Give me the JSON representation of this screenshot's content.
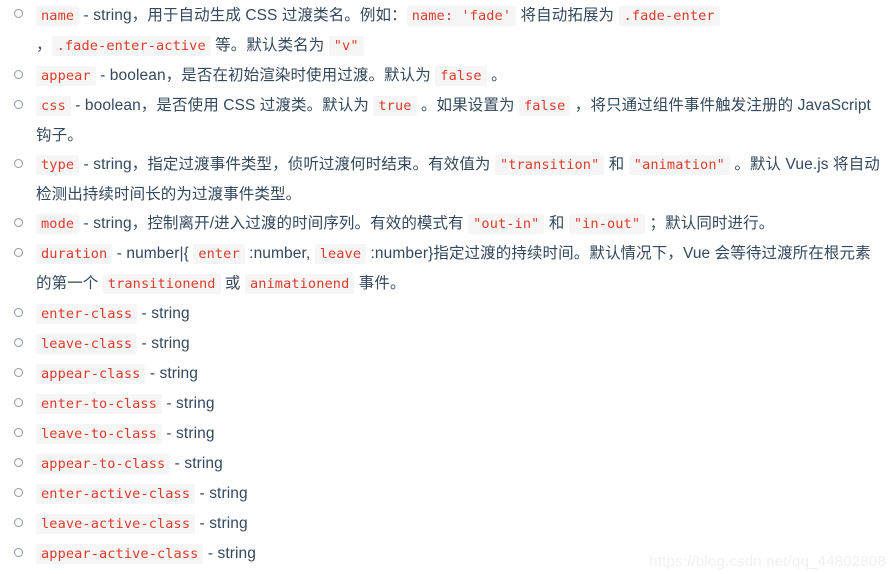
{
  "page": {
    "background": "#ffffff",
    "text_color": "#34495e",
    "code_color": "#e03c2b",
    "code_background": "#f6f6f6",
    "bullet_color": "#8d9aa8",
    "bullet_glyph": "circle-outline"
  },
  "watermark": {
    "text": "https://blog.csdn.net/qq_44802808",
    "color": "#f0f0f0"
  },
  "list": {
    "items": [
      {
        "name": "name-prop",
        "segments": [
          {
            "type": "code",
            "text": "name"
          },
          {
            "type": "text",
            "text": " - string，用于自动生成 CSS 过渡类名。例如："
          },
          {
            "type": "code",
            "text": "name: 'fade'"
          },
          {
            "type": "text",
            "text": " 将自动拓展为 "
          },
          {
            "type": "code",
            "text": ".fade-enter"
          },
          {
            "type": "text",
            "text": " ，"
          },
          {
            "type": "code",
            "text": ".fade-enter-active"
          },
          {
            "type": "text",
            "text": " 等。默认类名为 "
          },
          {
            "type": "code",
            "text": "\"v\""
          }
        ]
      },
      {
        "name": "appear-prop",
        "segments": [
          {
            "type": "code",
            "text": "appear"
          },
          {
            "type": "text",
            "text": " - boolean，是否在初始渲染时使用过渡。默认为 "
          },
          {
            "type": "code",
            "text": "false"
          },
          {
            "type": "text",
            "text": " 。"
          }
        ]
      },
      {
        "name": "css-prop",
        "segments": [
          {
            "type": "code",
            "text": "css"
          },
          {
            "type": "text",
            "text": " - boolean，是否使用 CSS 过渡类。默认为 "
          },
          {
            "type": "code",
            "text": "true"
          },
          {
            "type": "text",
            "text": " 。如果设置为 "
          },
          {
            "type": "code",
            "text": "false"
          },
          {
            "type": "text",
            "text": " ，将只通过组件事件触发注册的 JavaScript 钩子。"
          }
        ]
      },
      {
        "name": "type-prop",
        "segments": [
          {
            "type": "code",
            "text": "type"
          },
          {
            "type": "text",
            "text": " - string，指定过渡事件类型，侦听过渡何时结束。有效值为 "
          },
          {
            "type": "code",
            "text": "\"transition\""
          },
          {
            "type": "text",
            "text": " 和 "
          },
          {
            "type": "code",
            "text": "\"animation\""
          },
          {
            "type": "text",
            "text": " 。默认 Vue.js 将自动检测出持续时间长的为过渡事件类型。"
          }
        ]
      },
      {
        "name": "mode-prop",
        "segments": [
          {
            "type": "code",
            "text": "mode"
          },
          {
            "type": "text",
            "text": " - string，控制离开/进入过渡的时间序列。有效的模式有 "
          },
          {
            "type": "code",
            "text": "\"out-in\""
          },
          {
            "type": "text",
            "text": " 和 "
          },
          {
            "type": "code",
            "text": "\"in-out\""
          },
          {
            "type": "text",
            "text": " ；默认同时进行。"
          }
        ]
      },
      {
        "name": "duration-prop",
        "segments": [
          {
            "type": "code",
            "text": "duration"
          },
          {
            "type": "text",
            "text": " - number|{ "
          },
          {
            "type": "code",
            "text": "enter"
          },
          {
            "type": "text",
            "text": " :number, "
          },
          {
            "type": "code",
            "text": "leave"
          },
          {
            "type": "text",
            "text": " :number}指定过渡的持续时间。默认情况下，Vue 会等待过渡所在根元素的第一个 "
          },
          {
            "type": "code",
            "text": "transitionend"
          },
          {
            "type": "text",
            "text": " 或 "
          },
          {
            "type": "code",
            "text": "animationend"
          },
          {
            "type": "text",
            "text": " 事件。"
          }
        ]
      },
      {
        "name": "enter-class-prop",
        "segments": [
          {
            "type": "code",
            "text": "enter-class"
          },
          {
            "type": "text",
            "text": " - string"
          }
        ]
      },
      {
        "name": "leave-class-prop",
        "segments": [
          {
            "type": "code",
            "text": "leave-class"
          },
          {
            "type": "text",
            "text": " - string"
          }
        ]
      },
      {
        "name": "appear-class-prop",
        "segments": [
          {
            "type": "code",
            "text": "appear-class"
          },
          {
            "type": "text",
            "text": " - string"
          }
        ]
      },
      {
        "name": "enter-to-class-prop",
        "segments": [
          {
            "type": "code",
            "text": "enter-to-class"
          },
          {
            "type": "text",
            "text": " - string"
          }
        ]
      },
      {
        "name": "leave-to-class-prop",
        "segments": [
          {
            "type": "code",
            "text": "leave-to-class"
          },
          {
            "type": "text",
            "text": " - string"
          }
        ]
      },
      {
        "name": "appear-to-class-prop",
        "segments": [
          {
            "type": "code",
            "text": "appear-to-class"
          },
          {
            "type": "text",
            "text": " - string"
          }
        ]
      },
      {
        "name": "enter-active-class-prop",
        "segments": [
          {
            "type": "code",
            "text": "enter-active-class"
          },
          {
            "type": "text",
            "text": " - string"
          }
        ]
      },
      {
        "name": "leave-active-class-prop",
        "segments": [
          {
            "type": "code",
            "text": "leave-active-class"
          },
          {
            "type": "text",
            "text": " - string"
          }
        ]
      },
      {
        "name": "appear-active-class-prop",
        "segments": [
          {
            "type": "code",
            "text": "appear-active-class"
          },
          {
            "type": "text",
            "text": " - string"
          }
        ]
      }
    ]
  }
}
